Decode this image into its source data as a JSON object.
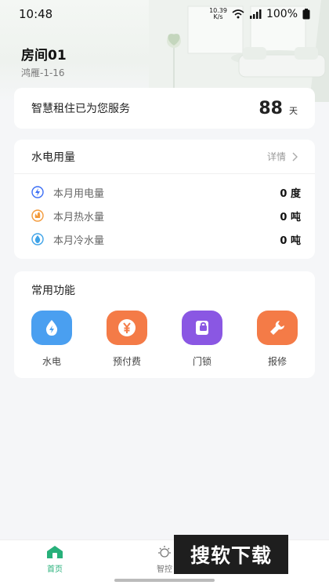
{
  "status_bar": {
    "time": "10:48",
    "speed_value": "10.39",
    "speed_unit": "K/s",
    "battery": "100%"
  },
  "header": {
    "room_name": "房间01",
    "address": "鸿雁-1-16"
  },
  "service": {
    "text": "智慧租住已为您服务",
    "days": "88",
    "days_unit": "天"
  },
  "usage": {
    "title": "水电用量",
    "detail_label": "详情",
    "rows": [
      {
        "icon": "lightning-icon",
        "label": "本月用电量",
        "value": "0 度",
        "color": "#3b6ef5"
      },
      {
        "icon": "hot-water-icon",
        "label": "本月热水量",
        "value": "0 吨",
        "color": "#f39a3b"
      },
      {
        "icon": "cold-water-icon",
        "label": "本月冷水量",
        "value": "0 吨",
        "color": "#3fa3e8"
      }
    ]
  },
  "functions": {
    "title": "常用功能",
    "items": [
      {
        "icon": "water-electric-icon",
        "label": "水电",
        "color": "#4a9ff0"
      },
      {
        "icon": "yuan-icon",
        "label": "预付费",
        "color": "#f47b47"
      },
      {
        "icon": "door-lock-icon",
        "label": "门锁",
        "color": "#8a57e3"
      },
      {
        "icon": "wrench-icon",
        "label": "报修",
        "color": "#f47b47"
      }
    ]
  },
  "tabbar": {
    "items": [
      {
        "icon": "home-icon",
        "label": "首页",
        "active": true
      },
      {
        "icon": "sun-icon",
        "label": "智控",
        "active": false
      }
    ]
  },
  "watermark": {
    "text": "搜软下载"
  },
  "colors": {
    "accent": "#27b07a",
    "background": "#f5f6f8"
  }
}
